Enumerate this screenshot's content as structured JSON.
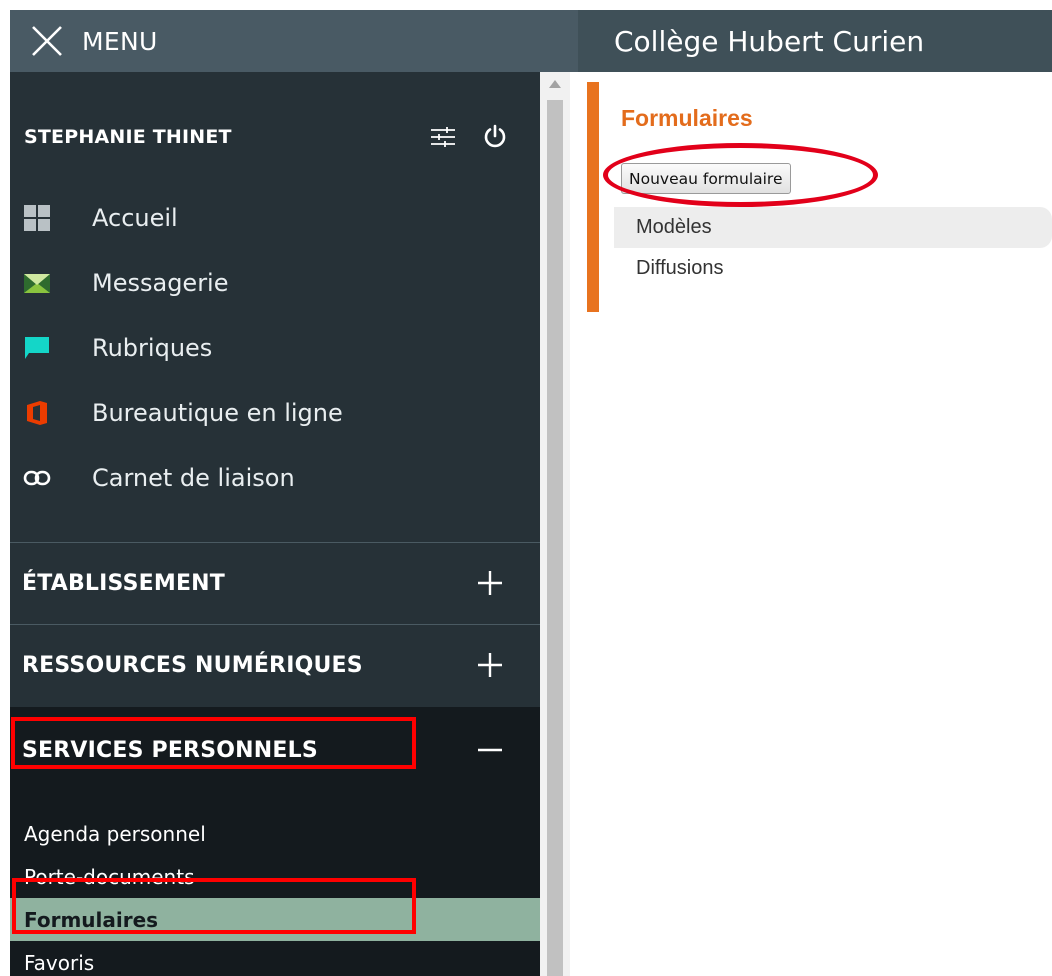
{
  "header": {
    "menu_label": "MENU",
    "app_title": "Collège Hubert Curien"
  },
  "sidebar": {
    "user_name": "STEPHANIE THINET",
    "nav_items": [
      {
        "label": "Accueil",
        "icon": "grid-icon"
      },
      {
        "label": "Messagerie",
        "icon": "mail-icon"
      },
      {
        "label": "Rubriques",
        "icon": "chat-icon"
      },
      {
        "label": "Bureautique en ligne",
        "icon": "office-icon"
      },
      {
        "label": "Carnet de liaison",
        "icon": "link-icon"
      }
    ],
    "sections": [
      {
        "label": "ÉTABLISSEMENT",
        "state": "collapsed"
      },
      {
        "label": "RESSOURCES NUMÉRIQUES",
        "state": "collapsed"
      },
      {
        "label": "SERVICES PERSONNELS",
        "state": "expanded"
      }
    ],
    "services_items": [
      {
        "label": "Agenda personnel"
      },
      {
        "label": "Porte-documents"
      },
      {
        "label": "Formulaires",
        "active": true
      },
      {
        "label": "Favoris"
      }
    ]
  },
  "content": {
    "title": "Formulaires",
    "new_button": "Nouveau formulaire",
    "items": [
      {
        "label": "Modèles",
        "active": true
      },
      {
        "label": "Diffusions"
      }
    ]
  },
  "colors": {
    "topbar": "#495a64",
    "sidebar_bg": "#263137",
    "accent_orange": "#e8731f",
    "active_green": "#8fb29f",
    "highlight_red": "#ff0000"
  }
}
